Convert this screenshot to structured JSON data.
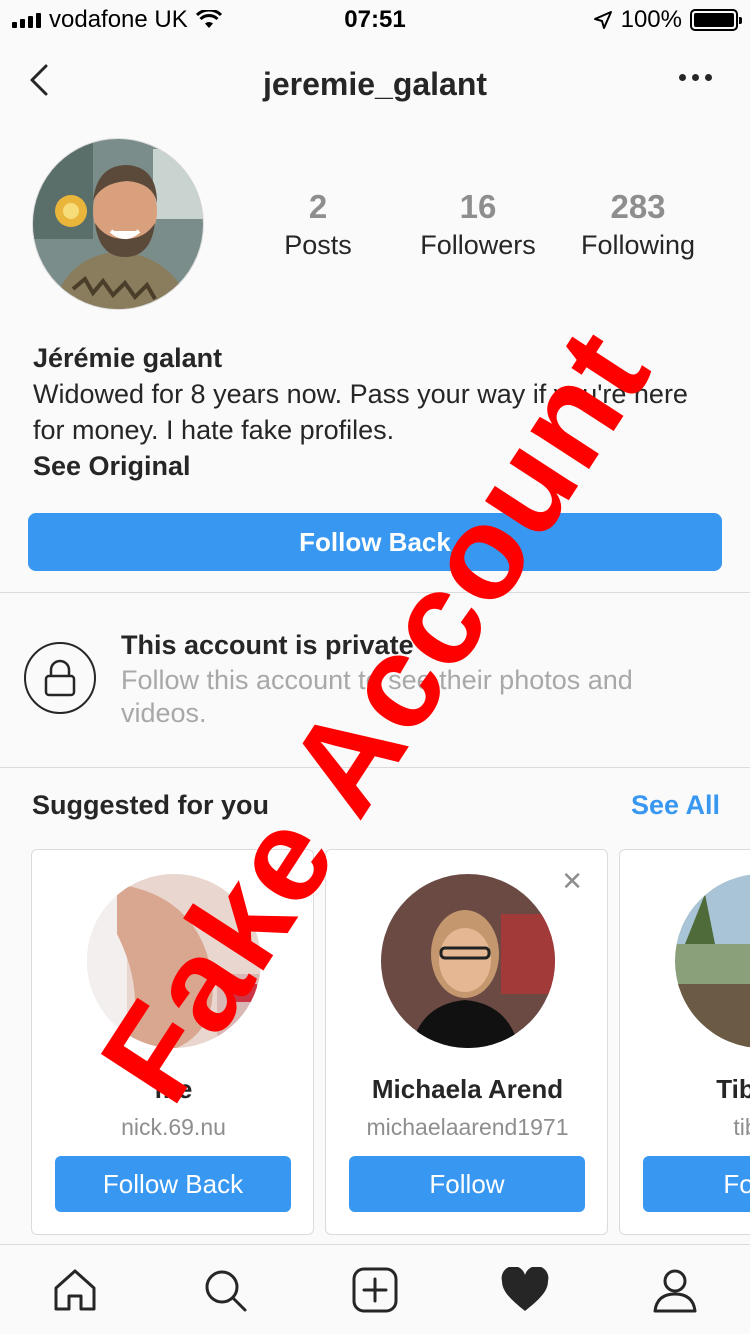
{
  "status_bar": {
    "carrier": "vodafone UK",
    "time": "07:51",
    "battery": "100%"
  },
  "header": {
    "username": "jeremie_galant"
  },
  "profile": {
    "stats": [
      {
        "value": "2",
        "label": "Posts"
      },
      {
        "value": "16",
        "label": "Followers"
      },
      {
        "value": "283",
        "label": "Following"
      }
    ],
    "display_name": "Jérémie galant",
    "bio": "Widowed for 8 years now. Pass your way if you're here for money. I hate fake profiles.",
    "see_original": "See Original",
    "follow_button": "Follow Back"
  },
  "private_notice": {
    "title": "This account is private",
    "subtitle": "Follow this account to see their photos and videos."
  },
  "suggestions": {
    "title": "Suggested for you",
    "see_all": "See All",
    "cards": [
      {
        "name": "me",
        "username": "nick.69.nu",
        "button": "Follow Back"
      },
      {
        "name": "Michaela Arend",
        "username": "michaelaarend1971",
        "button": "Follow"
      },
      {
        "name": "Tibor C",
        "username": "tiborc",
        "button": "Follow"
      }
    ]
  },
  "tab_bar": {
    "icons": [
      "home-icon",
      "search-icon",
      "add-post-icon",
      "activity-heart-icon",
      "profile-icon"
    ]
  },
  "overlay": {
    "text": "Fake Account",
    "color": "#ff0000"
  },
  "colors": {
    "accent": "#3897f0",
    "muted": "#8e8e8e"
  }
}
